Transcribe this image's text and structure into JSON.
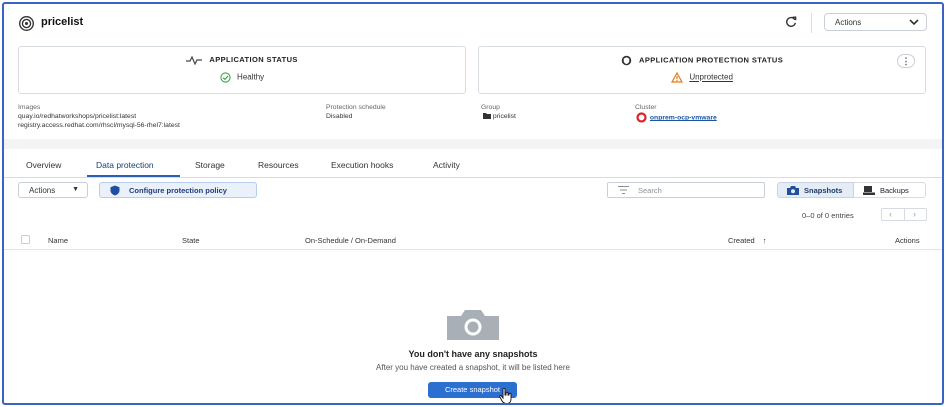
{
  "header": {
    "app_name": "pricelist",
    "actions_label": "Actions"
  },
  "status": {
    "app_title": "APPLICATION STATUS",
    "app_value": "Healthy",
    "protection_title": "APPLICATION PROTECTION STATUS",
    "protection_value": "Unprotected"
  },
  "meta": {
    "images_label": "Images",
    "images": [
      "quay.io/redhatworkshops/pricelist:latest",
      "registry.access.redhat.com/rhscl/mysql-56-rhel7:latest"
    ],
    "schedule_label": "Protection schedule",
    "schedule_value": "Disabled",
    "group_label": "Group",
    "group_value": "pricelist",
    "cluster_label": "Cluster",
    "cluster_value": "onprem-ocp-vmware"
  },
  "tabs": [
    {
      "label": "Overview"
    },
    {
      "label": "Data protection"
    },
    {
      "label": "Storage"
    },
    {
      "label": "Resources"
    },
    {
      "label": "Execution hooks"
    },
    {
      "label": "Activity"
    }
  ],
  "toolbar": {
    "actions_label": "Actions",
    "configure_label": "Configure protection policy",
    "search_placeholder": "Search",
    "snapshots_label": "Snapshots",
    "backups_label": "Backups",
    "entries": "0–0 of 0 entries"
  },
  "table": {
    "columns": [
      "Name",
      "State",
      "On-Schedule / On-Demand",
      "Created",
      "Actions"
    ]
  },
  "empty": {
    "title": "You don't have any snapshots",
    "subtitle": "After you have created a snapshot, it will be listed here",
    "button": "Create snapshot"
  },
  "colors": {
    "accent": "#2b6fd0",
    "healthy": "#3ea44a",
    "warning": "#e07b1a",
    "frame": "#3b63c4"
  }
}
